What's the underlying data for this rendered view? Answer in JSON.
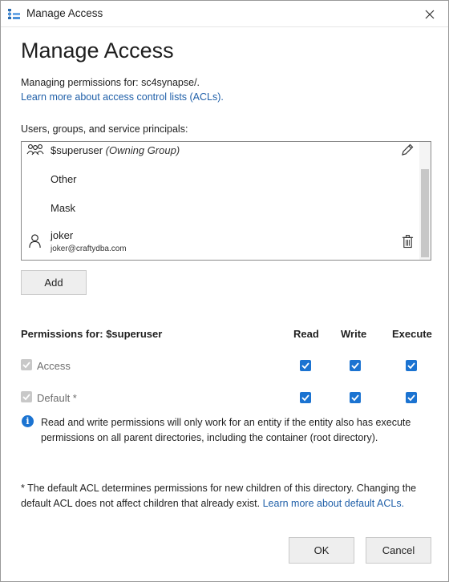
{
  "window": {
    "title": "Manage Access",
    "icon": "storage-explorer-icon",
    "close_icon": "close-icon"
  },
  "heading": "Manage Access",
  "managing_text": "Managing permissions for: sc4synapse/.",
  "learn_acl_link": "Learn more about access control lists (ACLs).",
  "principals_label": "Users, groups, and service principals:",
  "principals": [
    {
      "name": "$superuser",
      "suffix": "(Owning Group)",
      "icon": "group-icon",
      "action_icon": "edit-icon"
    },
    {
      "name": "Other"
    },
    {
      "name": "Mask"
    },
    {
      "name": "joker",
      "subtitle": "joker@craftydba.com",
      "icon": "user-icon",
      "action_icon": "trash-icon"
    }
  ],
  "add_button": "Add",
  "permissions": {
    "header": "Permissions for: $superuser",
    "columns": [
      "Read",
      "Write",
      "Execute"
    ],
    "rows": [
      {
        "label": "Access",
        "enabled": true,
        "read": true,
        "write": true,
        "execute": true
      },
      {
        "label": "Default *",
        "enabled": true,
        "read": true,
        "write": true,
        "execute": true
      }
    ]
  },
  "info_text": "Read and write permissions will only work for an entity if the entity also has execute permissions on all parent directories, including the container (root directory).",
  "footnote": {
    "text": "* The default ACL determines permissions for new children of this directory. Changing the default ACL does not affect children that already exist.",
    "link": "Learn more about default ACLs."
  },
  "buttons": {
    "ok": "OK",
    "cancel": "Cancel"
  },
  "colors": {
    "accent": "#1b73d1",
    "link": "#1f5fa8"
  }
}
